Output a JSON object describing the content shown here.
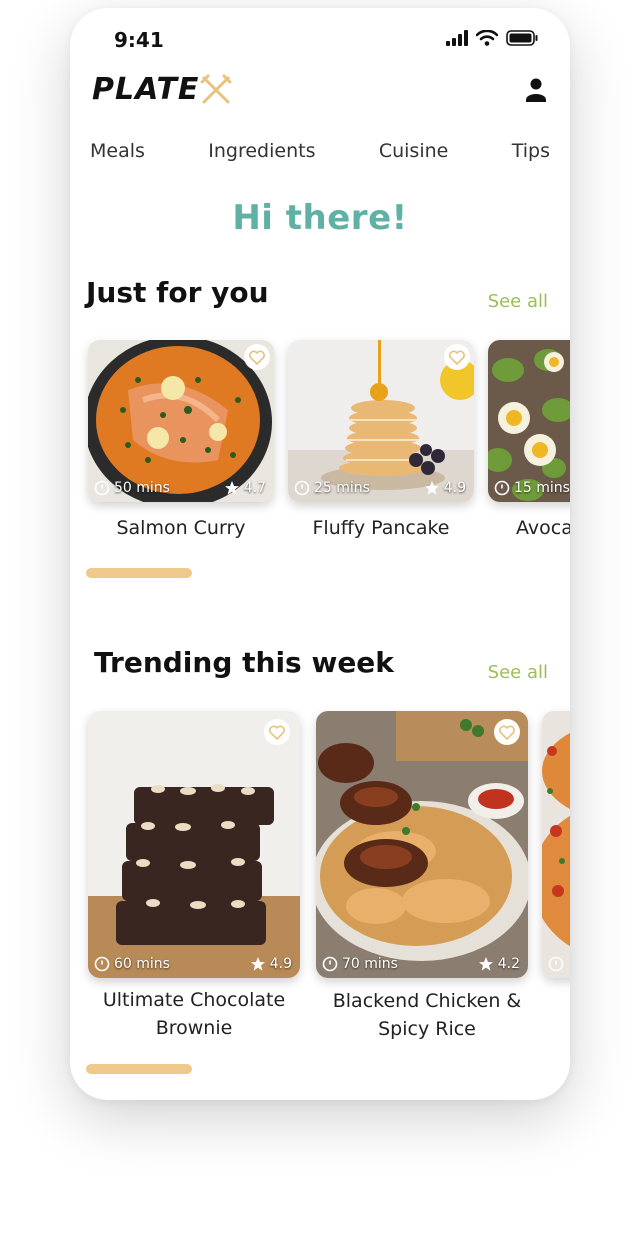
{
  "status": {
    "time": "9:41"
  },
  "logo": {
    "text": "PLATE"
  },
  "nav": [
    "Meals",
    "Ingredients",
    "Cuisine",
    "Tips"
  ],
  "greeting": "Hi there!",
  "sections": {
    "for_you": {
      "title": "Just for you",
      "see_all": "See all",
      "cards": [
        {
          "title": "Salmon Curry",
          "time": "50 mins",
          "rating": "4.7"
        },
        {
          "title": "Fluffy Pancake",
          "time": "25 mins",
          "rating": "4.9"
        },
        {
          "title": "Avoca",
          "time": "15 mins",
          "rating": ""
        }
      ]
    },
    "trending": {
      "title": "Trending this week",
      "see_all": "See all",
      "cards": [
        {
          "title": "Ultimate Chocolate Brownie",
          "time": "60 mins",
          "rating": "4.9"
        },
        {
          "title": "Blackend Chicken & Spicy Rice",
          "time": "70 mins",
          "rating": "4.2"
        },
        {
          "title": "",
          "time": "",
          "rating": ""
        }
      ]
    }
  },
  "colors": {
    "accent_teal": "#5fb0a5",
    "link_green": "#9bbe58",
    "indicator": "#eec98b",
    "heart": "#e8c27e"
  }
}
